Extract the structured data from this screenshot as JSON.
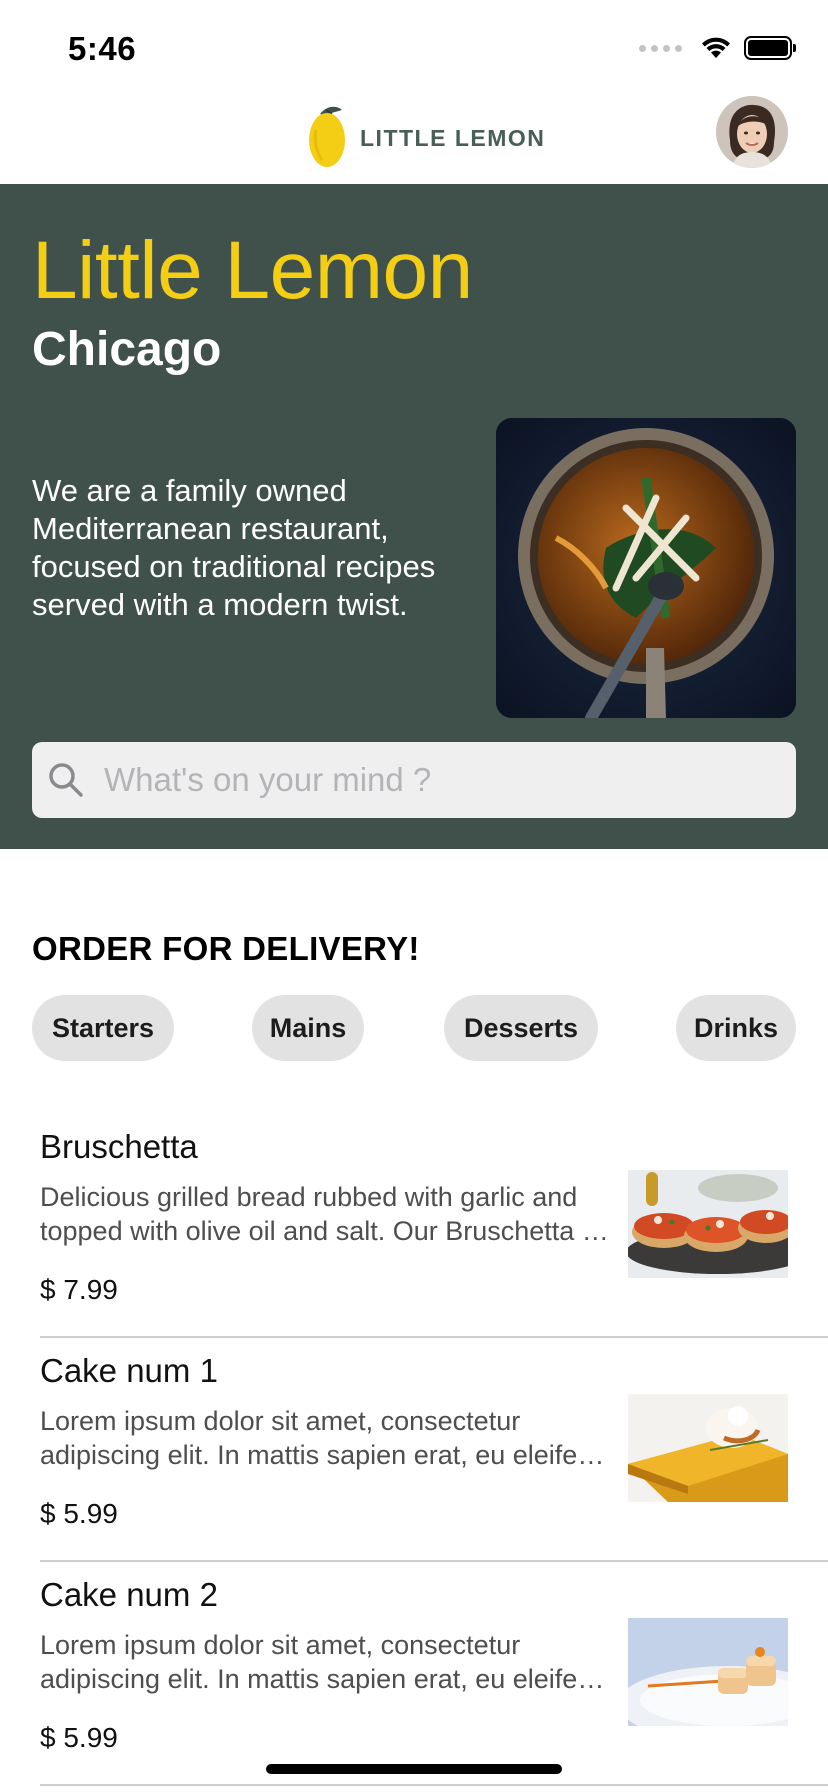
{
  "status_bar": {
    "time": "5:46"
  },
  "header": {
    "logo_text": "LITTLE LEMON"
  },
  "hero": {
    "title": "Little Lemon",
    "subtitle": "Chicago",
    "description": "We are a family owned Mediterranean restaurant, focused on traditional recipes served with a modern twist."
  },
  "search": {
    "placeholder": "What's on your mind ?"
  },
  "order": {
    "title": "ORDER FOR DELIVERY!",
    "categories": [
      "Starters",
      "Mains",
      "Desserts",
      "Drinks"
    ]
  },
  "menu": [
    {
      "name": "Bruschetta",
      "description": "Delicious grilled bread rubbed with garlic and topped with olive oil and salt. Our Bruschetta is made from grilled bread that has been smeared with garlic and seasoned with salt and olive oil.",
      "price": "$  7.99"
    },
    {
      "name": "Cake num 1",
      "description": "Lorem ipsum dolor sit amet, consectetur adipiscing elit. In mattis sapien erat, eu eleifend justo ultricies vitae.",
      "price": "$  5.99"
    },
    {
      "name": "Cake num 2",
      "description": "Lorem ipsum dolor sit amet, consectetur adipiscing elit. In mattis sapien erat, eu eleifend justo ultricies vitae.",
      "price": "$  5.99"
    }
  ],
  "colors": {
    "primary_green": "#3F514A",
    "primary_yellow": "#F4CE14",
    "pill_bg": "#E2E2E2"
  },
  "icons": {
    "logo": "lemon-icon",
    "search": "search-icon",
    "signal": "cellular-signal-icon",
    "wifi": "wifi-icon",
    "battery": "battery-icon"
  }
}
